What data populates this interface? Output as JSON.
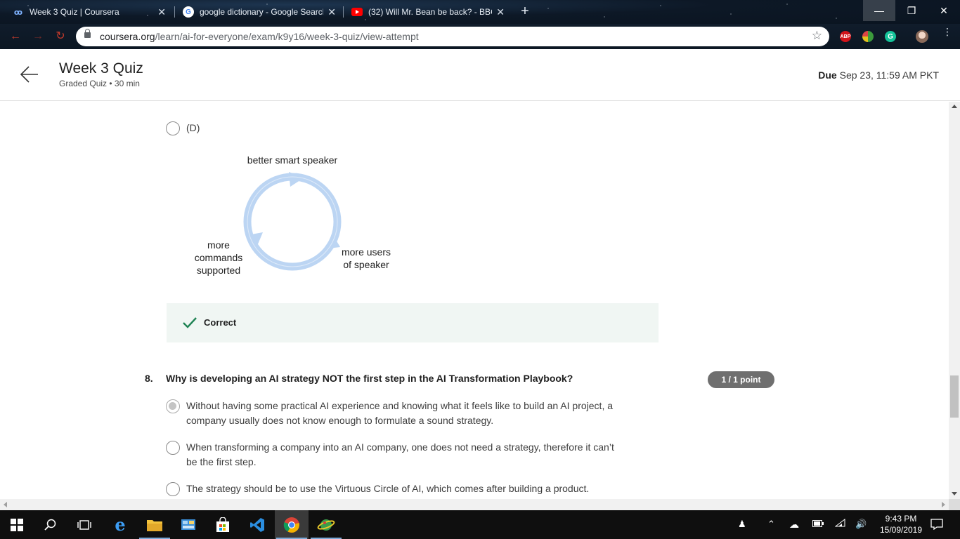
{
  "browser": {
    "tabs": [
      {
        "title": "Week 3 Quiz | Coursera",
        "favicon": "coursera-icon",
        "active": true
      },
      {
        "title": "google dictionary - Google Search",
        "favicon": "google-icon",
        "active": false
      },
      {
        "title": "(32) Will Mr. Bean be back? - BBC",
        "favicon": "youtube-icon",
        "active": false
      }
    ],
    "new_tab": "+",
    "url_host": "coursera.org",
    "url_path": "/learn/ai-for-everyone/exam/k9y16/week-3-quiz/view-attempt",
    "extensions": {
      "abp": "ABP",
      "grammarly": "G"
    }
  },
  "header": {
    "title": "Week 3 Quiz",
    "subtitle": "Graded Quiz • 30 min",
    "due_label": "Due",
    "due_value": "Sep 23, 11:59 AM PKT"
  },
  "prev_question": {
    "option_d_label": "(D)",
    "diagram": {
      "top": "better smart speaker",
      "right_line1": "more users",
      "right_line2": "of speaker",
      "left_line1": "more",
      "left_line2": "commands",
      "left_line3": "supported",
      "arrow_color": "#b9d3f2"
    },
    "feedback": "Correct"
  },
  "question8": {
    "number": "8.",
    "text": "Why is developing an AI strategy NOT the first step in the AI Transformation Playbook?",
    "points": "1 / 1 point",
    "options": [
      {
        "line1": "Without having some practical AI experience and knowing what it feels like to build an AI project, a",
        "line2": "company usually does not know enough to formulate a sound strategy.",
        "selected": true
      },
      {
        "line1": "When transforming a company into an AI company, one does not need a strategy, therefore it can’t",
        "line2": "be the first step.",
        "selected": false
      },
      {
        "line1": "The strategy should be to use the Virtuous Circle of AI, which comes after building a product.",
        "line2": "",
        "selected": false
      }
    ]
  },
  "taskbar": {
    "time": "9:43 PM",
    "date": "15/09/2019"
  },
  "colors": {
    "correct_green": "#1f8354",
    "feedback_bg": "#f0f6f3",
    "points_badge": "#6f6f6f"
  }
}
